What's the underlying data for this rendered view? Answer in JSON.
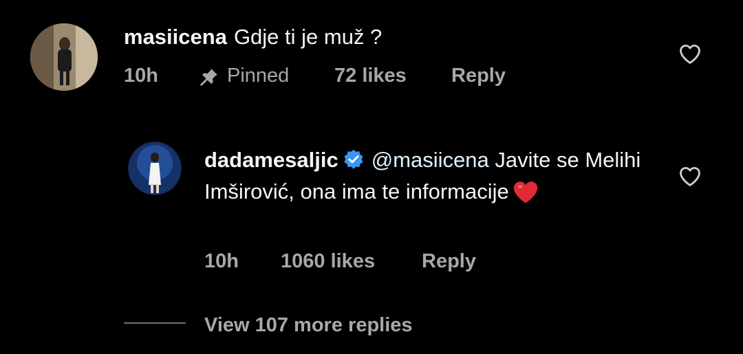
{
  "comment1": {
    "username": "masiicena",
    "text": "Gdje ti je muž ?",
    "time": "10h",
    "pinned_label": "Pinned",
    "likes": "72 likes",
    "reply_label": "Reply"
  },
  "comment2": {
    "username": "dadamesaljic",
    "mention": "@masiicena",
    "text": "Javite se Melihi Imširović, ona ima te informacije",
    "time": "10h",
    "likes": "1060 likes",
    "reply_label": "Reply"
  },
  "view_more": "View 107 more replies",
  "colors": {
    "background": "#000000",
    "meta_text": "#a8a8a8",
    "verified_blue": "#3897f0",
    "heart_red": "#e02a38"
  },
  "icons": [
    "pin-icon",
    "heart-outline-icon",
    "verified-badge-icon",
    "red-heart-emoji"
  ]
}
